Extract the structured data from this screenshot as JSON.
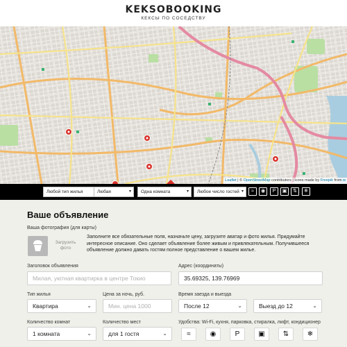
{
  "header": {
    "title": "KEKSOBOOKING",
    "subtitle": "КЕКСЫ ПО СОСЕДСТВУ"
  },
  "map": {
    "attribution": {
      "leaflet": "Leaflet",
      "sep1": " | © ",
      "osm": "OpenStreetMap",
      "rest": " contributors | Icons made by ",
      "freepik": "Freepik",
      "from": " from ",
      "flat": "w"
    }
  },
  "filters": {
    "type": "Любой тип жилья",
    "price": "Любая",
    "rooms": "Одна комната",
    "guests": "Любое число гостей",
    "feature_icons": [
      "wifi-icon",
      "dishwasher-icon",
      "parking-icon",
      "washer-icon",
      "elevator-icon",
      "conditioner-icon"
    ]
  },
  "form": {
    "heading": "Ваше объявление",
    "photo_label": "Ваша фотография (для карты)",
    "upload_line1": "Загрузить",
    "upload_line2": "фото",
    "description": "Заполните все обязательные поля, назначьте цену, загрузите аватар и фото жилья. Придумайте интересное описание. Оно сделает объявление более живым и привлекательным. Получившееся объявление должно давать гостям полное представление о вашем жилье.",
    "title_label": "Заголовок объявления",
    "title_placeholder": "Милая, уютная квартирка в центре Токио",
    "address_label": "Адрес (координаты)",
    "address_value": "35.69325, 139.76969",
    "type_label": "Тип жилья",
    "type_value": "Квартира",
    "price_label": "Цена за ночь, руб.",
    "price_placeholder": "Мин. цена 1000",
    "time_label": "Время заезда и выезда",
    "checkin_value": "После 12",
    "checkout_value": "Выезд до 12",
    "rooms_label": "Количество комнат",
    "rooms_value": "1 комната",
    "capacity_label": "Количество мест",
    "capacity_value": "для 1 гостя",
    "features_label": "Удобства: Wi-Fi, кухня, парковка, стиралка, лифт, кондиционер",
    "feature_icons": [
      "wifi-icon",
      "dishwasher-icon",
      "parking-icon",
      "washer-icon",
      "elevator-icon",
      "conditioner-icon"
    ]
  },
  "colors": {
    "background": "#f0f0ea",
    "filter_bar": "#000000",
    "pin": "#d9312b",
    "map_base": "#e6e2dc"
  }
}
